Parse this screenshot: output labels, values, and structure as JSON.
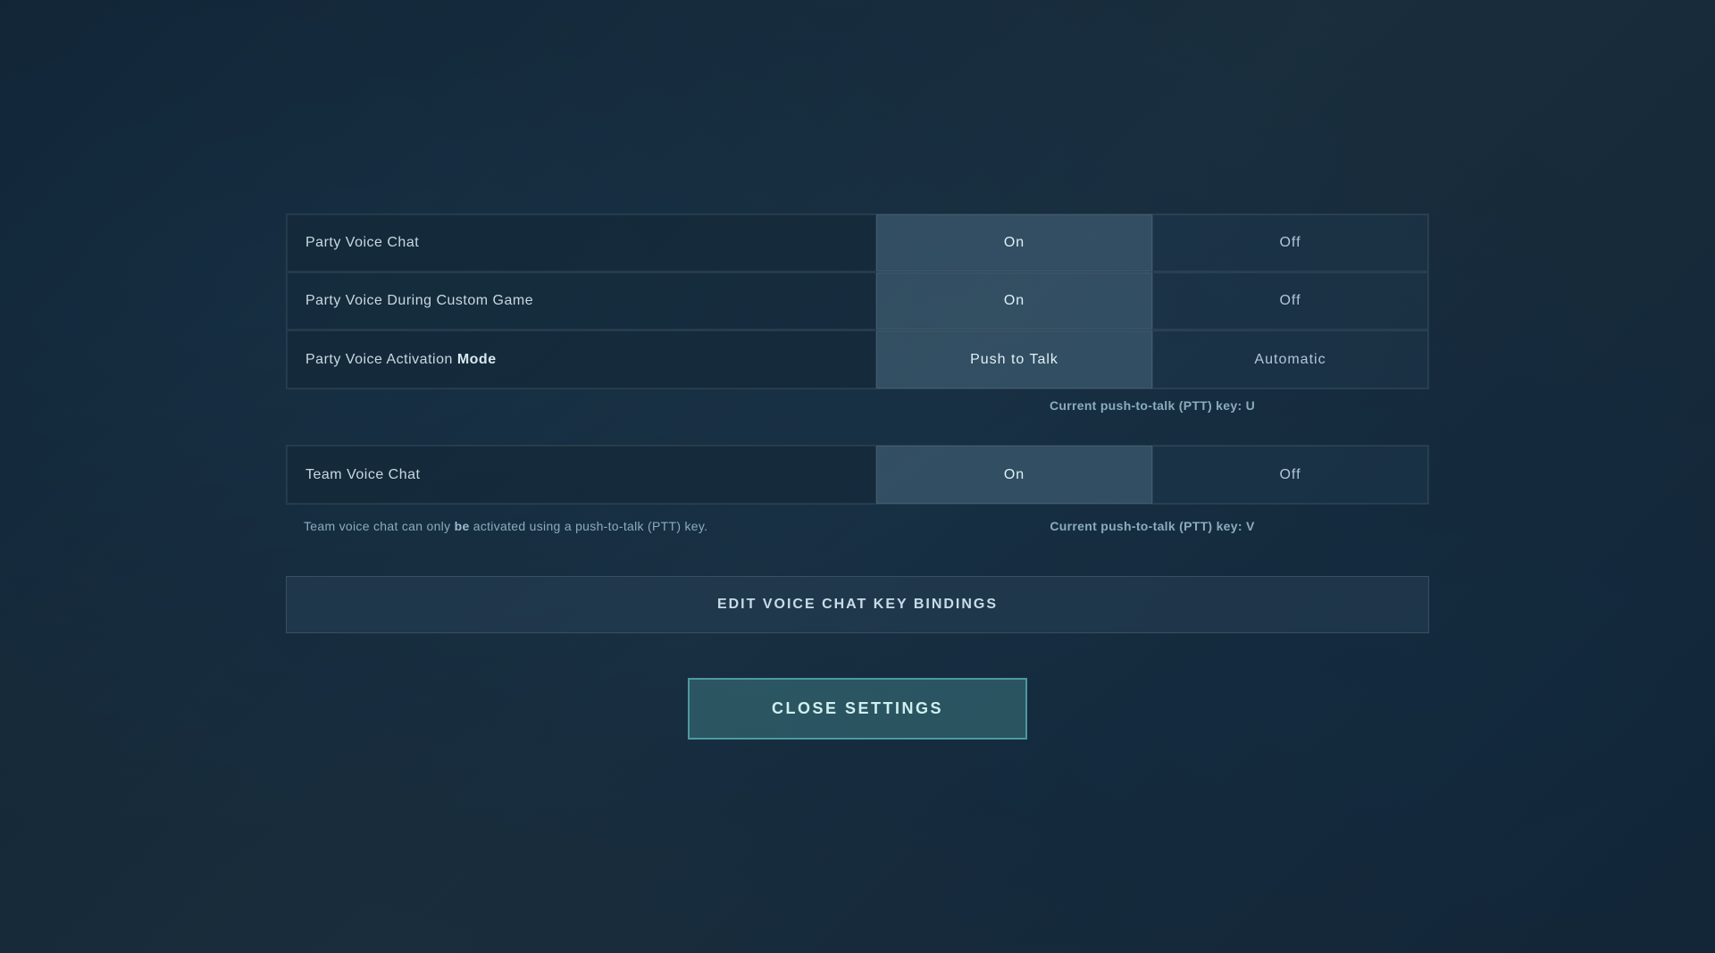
{
  "settings": {
    "party_voice_chat": {
      "label": "Party Voice Chat",
      "selected": "on",
      "on_label": "On",
      "off_label": "Off"
    },
    "party_voice_custom_game": {
      "label_start": "Party Voice During Custom Game",
      "label_bold": "",
      "selected": "on",
      "on_label": "On",
      "off_label": "Off"
    },
    "party_voice_activation": {
      "label_start": "Party Voice Activation ",
      "label_bold": "Mode",
      "selected": "push_to_talk",
      "push_to_talk_label": "Push to Talk",
      "automatic_label": "Automatic",
      "ptt_key_text": "Current push-to-talk (PTT) key: U"
    },
    "team_voice_chat": {
      "label": "Team Voice Chat",
      "selected": "on",
      "on_label": "On",
      "off_label": "Off",
      "info_text_start": "Team voice chat can only ",
      "info_text_bold": "be",
      "info_text_end": " activated using a push-to-talk (PTT) key.",
      "ptt_key_text": "Current push-to-talk (PTT) key: V"
    }
  },
  "buttons": {
    "edit_bindings_label": "EDIT VOICE CHAT KEY BINDINGS",
    "close_settings_label": "CLOSE SETTINGS"
  }
}
